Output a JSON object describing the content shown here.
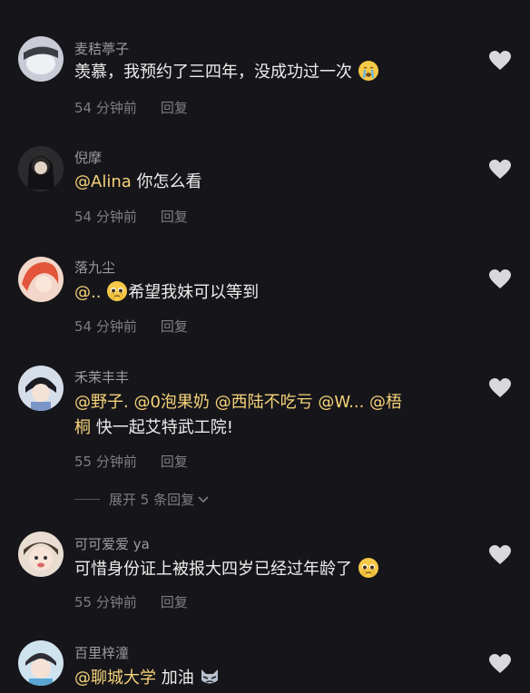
{
  "comments": [
    {
      "username": "麦秸葶子",
      "text": "羡慕，我预约了三四年，没成功过一次",
      "time": "54 分钟前",
      "reply": "回复",
      "emoji": "crying-face"
    },
    {
      "username": "倪摩",
      "mention": "@Alina",
      "text": " 你怎么看",
      "time": "54 分钟前",
      "reply": "回复"
    },
    {
      "username": "落九尘",
      "mention": "@..",
      "text": "希望我妹可以等到",
      "time": "54 分钟前",
      "reply": "回复",
      "emoji": "pleading-face"
    },
    {
      "username": "禾茉丰丰",
      "mentions": [
        "@野子.",
        "@0泡果奶",
        "@西陆不吃亏",
        "@W...",
        "@梧"
      ],
      "mention_cont": "桐",
      "text": " 快一起艾特武工院!",
      "time": "55 分钟前",
      "reply": "回复"
    },
    {
      "username": "可可爱爱 ya",
      "text": "可惜身份证上被报大四岁已经过年龄了",
      "time": "55 分钟前",
      "reply": "回复",
      "emoji": "pleading-face"
    },
    {
      "username": "百里梓潼",
      "mention": "@聊城大学",
      "text": " 加油",
      "emoji": "cat-face"
    }
  ],
  "expand_replies": "展开 5 条回复",
  "colors": {
    "background": "#16161a",
    "mention": "#f6d27a",
    "meta": "#7d7d82",
    "like": "#d9d9dc"
  }
}
